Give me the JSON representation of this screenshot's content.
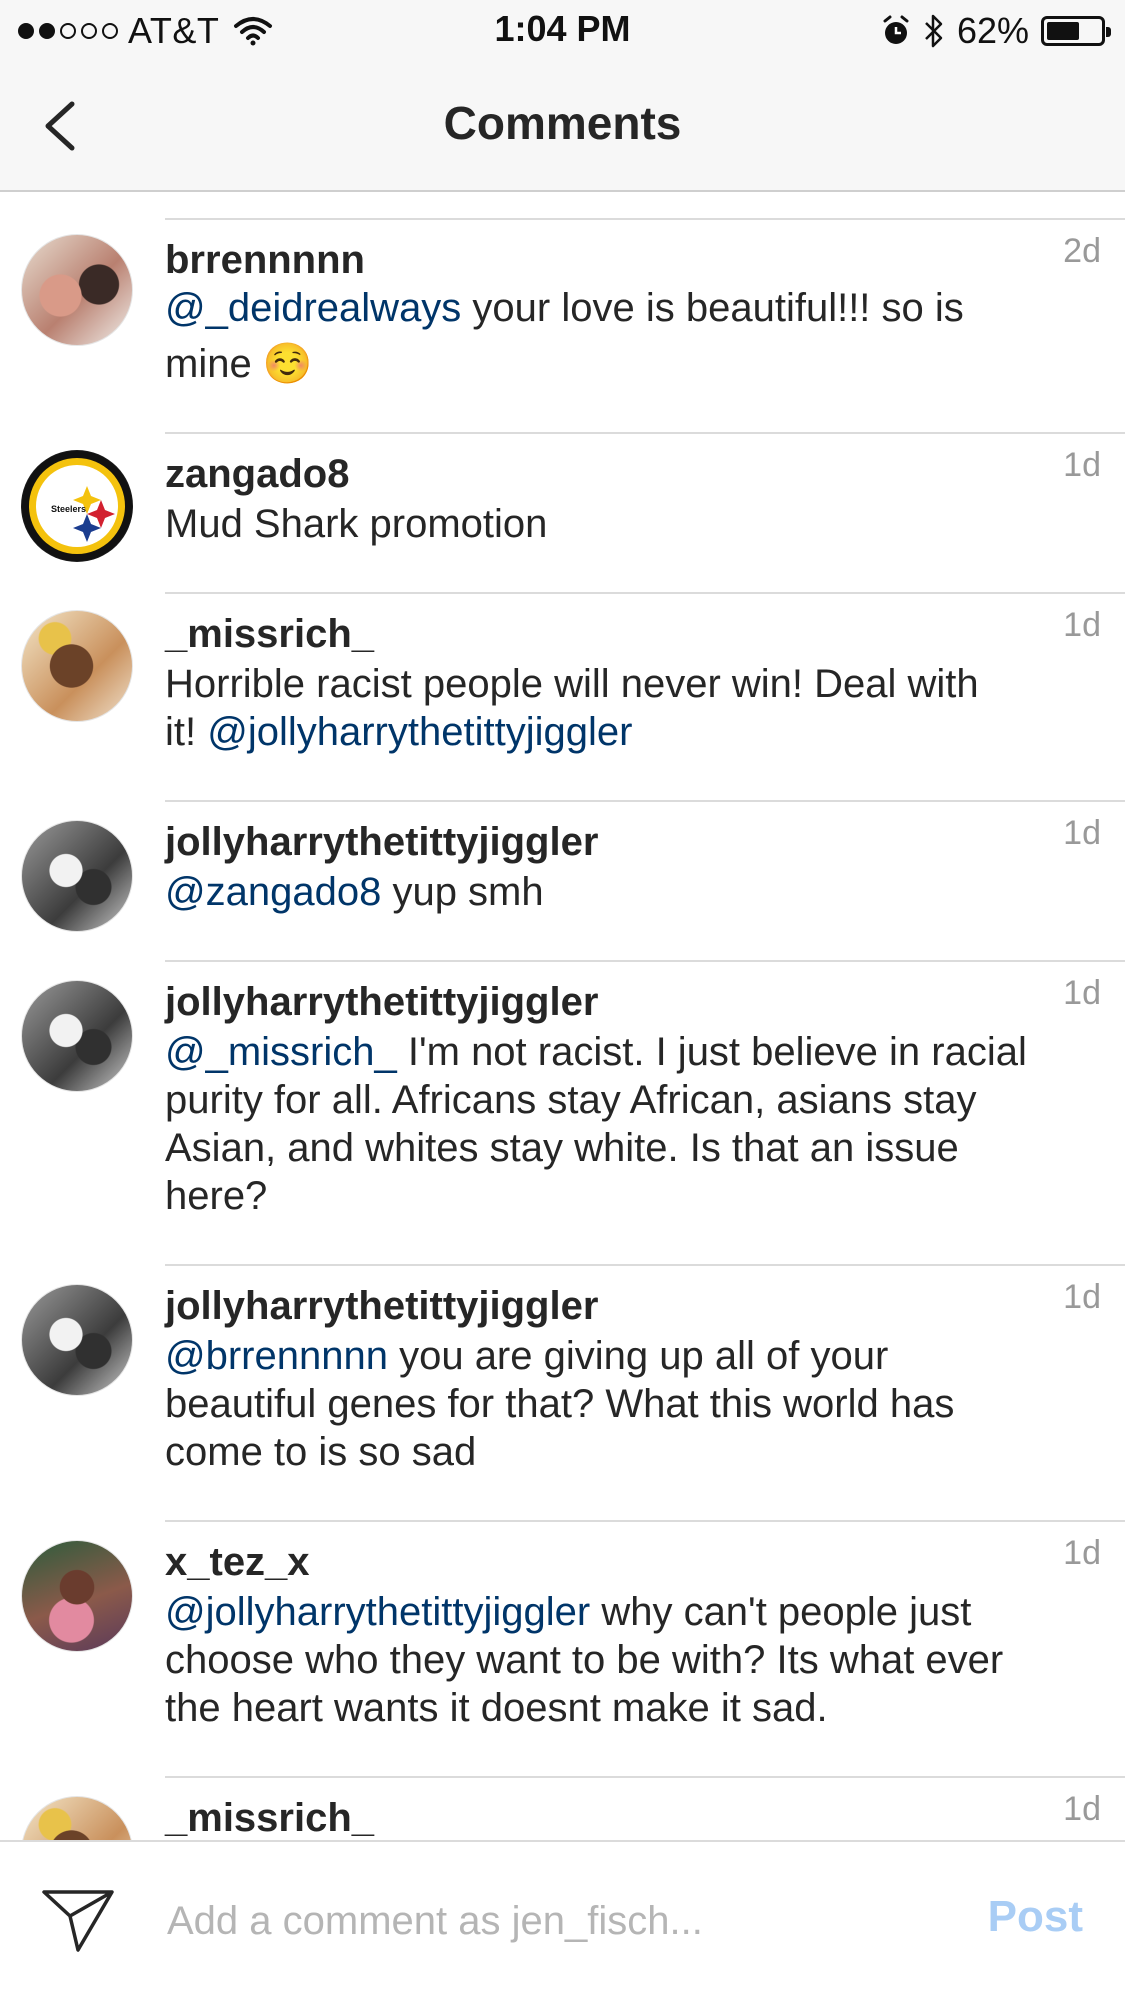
{
  "status_bar": {
    "carrier": "AT&T",
    "time": "1:04 PM",
    "battery_percent": "62%",
    "battery_level": 0.62,
    "signal_bars_filled": 2,
    "signal_bars_total": 5
  },
  "nav": {
    "title": "Comments",
    "back_icon": "chevron-left-icon"
  },
  "comments": [
    {
      "username": "brrennnnn",
      "time": "2d",
      "mention": "@_deidrealways",
      "text_line1_rest": " your love is beautiful!!! so is",
      "text_line2": "mine ☺️"
    },
    {
      "username": "zangado8",
      "time": "1d",
      "text": "Mud Shark promotion",
      "avatar_text": "Steelers"
    },
    {
      "username": "_missrich_",
      "time": "1d",
      "text_line1": "Horrible racist people will never win! Deal with",
      "text_line2_pre": "it! ",
      "mention": "@jollyharrythetittyjiggler"
    },
    {
      "username": "jollyharrythetittyjiggler",
      "time": "1d",
      "mention": "@zangado8",
      "text_rest": " yup smh"
    },
    {
      "username": "jollyharrythetittyjiggler",
      "time": "1d",
      "mention": "@_missrich_",
      "text_line1_rest": " I'm not racist. I just believe in racial",
      "text_line2": "purity for all. Africans stay African, asians stay",
      "text_line3": "Asian, and whites stay white. Is that an issue",
      "text_line4": "here?"
    },
    {
      "username": "jollyharrythetittyjiggler",
      "time": "1d",
      "mention": "@brrennnnn",
      "text_line1_rest": " you are giving up all of your",
      "text_line2": "beautiful genes for that? What this world has",
      "text_line3": "come to is so sad"
    },
    {
      "username": "x_tez_x",
      "time": "1d",
      "mention": "@jollyharrythetittyjiggler",
      "text_line1_rest": " why can't people just",
      "text_line2": "choose who they want to be with? Its what ever",
      "text_line3": "the heart wants it doesnt make it sad."
    },
    {
      "username": "_missrich_",
      "time": "1d"
    }
  ],
  "input_bar": {
    "placeholder": "Add a comment as jen_fisch...",
    "post_label": "Post",
    "send_icon": "paper-plane-icon"
  },
  "colors": {
    "mention": "#003569",
    "post_disabled": "#a9cdf5",
    "timestamp": "#999999",
    "separator": "#dbdbdb"
  }
}
